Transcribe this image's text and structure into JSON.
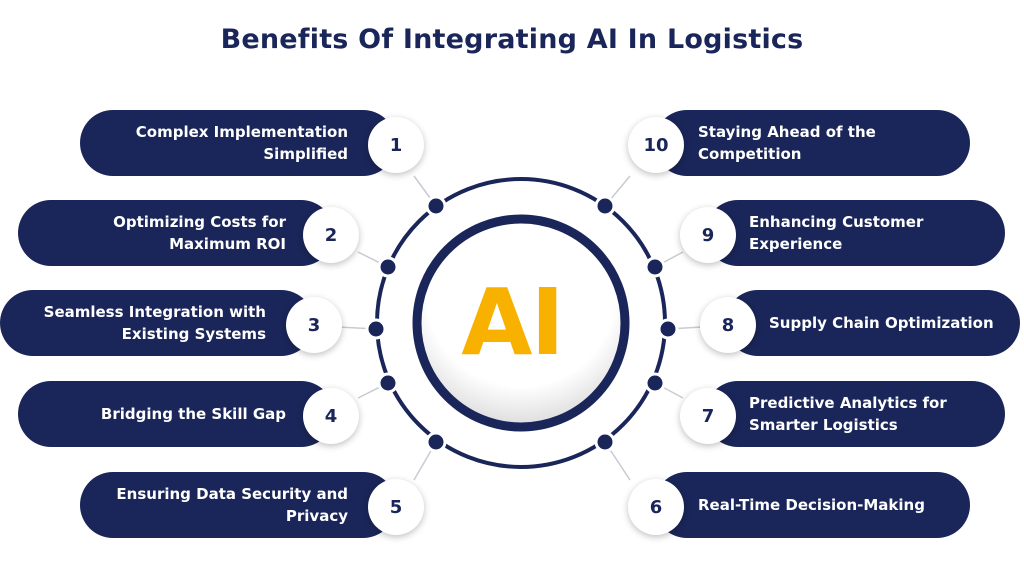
{
  "title": "Benefits Of Integrating AI In Logistics",
  "center_label": "AI",
  "colors": {
    "navy": "#1a2659",
    "accent": "#f9b100",
    "background": "#ffffff"
  },
  "benefits": [
    {
      "number": "1",
      "text": "Complex Implementation Simplified"
    },
    {
      "number": "2",
      "text": "Optimizing Costs for Maximum ROI"
    },
    {
      "number": "3",
      "text": "Seamless Integration with Existing Systems"
    },
    {
      "number": "4",
      "text": "Bridging the Skill Gap"
    },
    {
      "number": "5",
      "text": "Ensuring Data Security and Privacy"
    },
    {
      "number": "6",
      "text": "Real-Time Decision-Making"
    },
    {
      "number": "7",
      "text": "Predictive Analytics for Smarter Logistics"
    },
    {
      "number": "8",
      "text": "Supply Chain Optimization"
    },
    {
      "number": "9",
      "text": "Enhancing Customer Experience"
    },
    {
      "number": "10",
      "text": "Staying Ahead of the Competition"
    }
  ]
}
